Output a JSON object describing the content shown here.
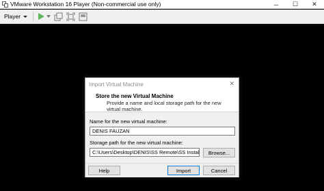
{
  "window": {
    "title": "VMware Workstation 16 Player (Non-commercial use only)",
    "minimize": "─",
    "maximize": "☐",
    "close": "✕"
  },
  "toolbar": {
    "player_menu": "Player",
    "play_color": "#5cb85c"
  },
  "dialog": {
    "title": "Import Virtual Machine",
    "close": "✕",
    "heading": "Store the new Virtual Machine",
    "description": "Provide a name and local storage path for the new virtual machine.",
    "name_label": "Name for the new virtual machine:",
    "name_value": "DENIS FAUZAN",
    "path_label": "Storage path for the new virtual machine:",
    "path_value": "C:\\Users\\Desktop\\DENIS\\SS Remote\\SS Instalasi",
    "browse_label": "Browse...",
    "help_label": "Help",
    "import_label": "Import",
    "cancel_label": "Cancel"
  }
}
